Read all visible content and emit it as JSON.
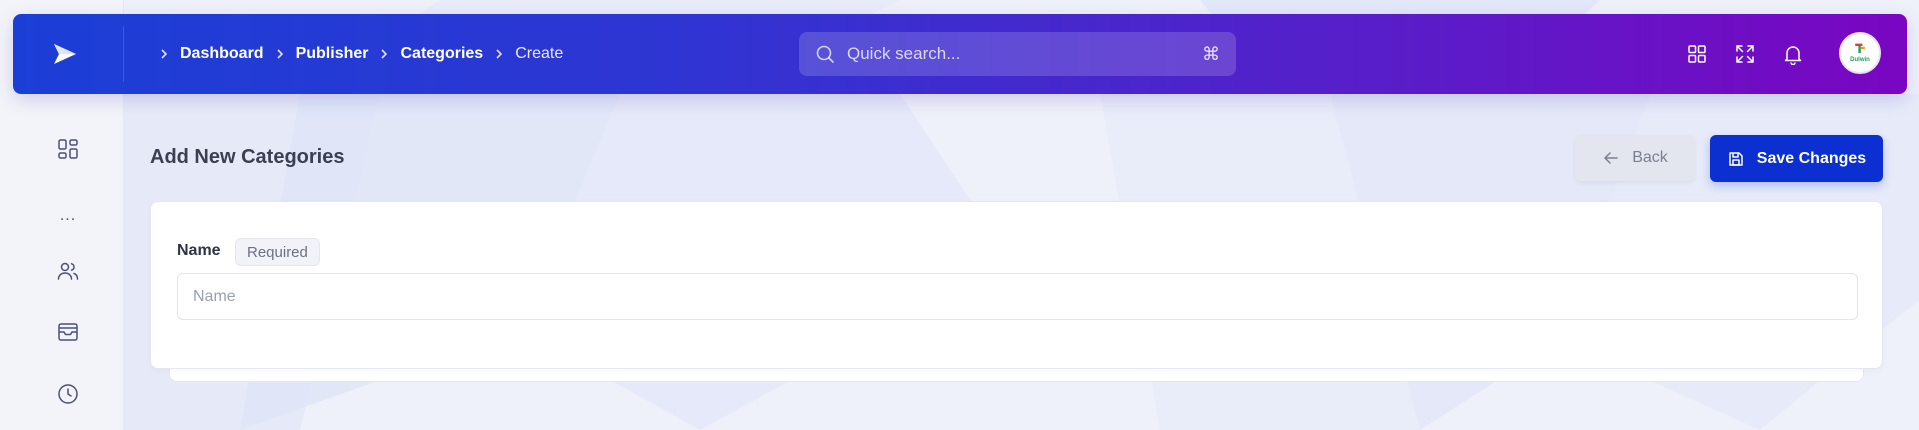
{
  "header": {
    "breadcrumb": [
      "Dashboard",
      "Publisher",
      "Categories",
      "Create"
    ],
    "search": {
      "placeholder": "Quick search...",
      "shortcut": "⌘"
    },
    "avatar_text": "Dulwin"
  },
  "page": {
    "title": "Add New Categories",
    "back_label": "Back",
    "save_label": "Save Changes"
  },
  "form": {
    "name_label": "Name",
    "required_badge": "Required",
    "name_placeholder": "Name",
    "name_value": ""
  },
  "sidebar": {
    "items": [
      "grid-icon",
      "more-dots",
      "users-icon",
      "archive-icon",
      "clock-icon"
    ],
    "more_text": "..."
  },
  "colors": {
    "header_gradient_start": "#1b3fd6",
    "header_gradient_end": "#7a06c2",
    "primary_button": "#0b2fd1"
  }
}
